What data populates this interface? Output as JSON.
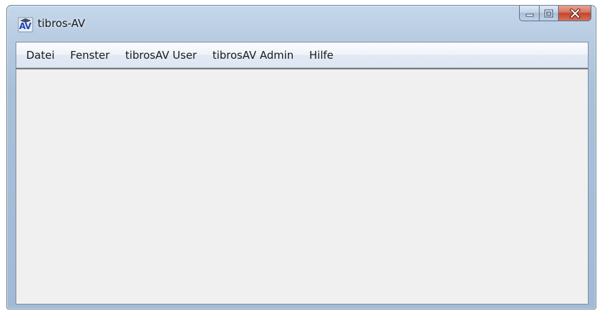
{
  "window": {
    "title": "tibros-AV",
    "icon": "tibros-av-app-icon",
    "controls": {
      "minimize_icon": "minimize-icon",
      "maximize_icon": "maximize-icon",
      "close_icon": "close-icon",
      "close_color": "#c2452a"
    }
  },
  "menubar": {
    "items": [
      {
        "label": "Datei"
      },
      {
        "label": "Fenster"
      },
      {
        "label": "tibrosAV User"
      },
      {
        "label": "tibrosAV Admin"
      },
      {
        "label": "Hilfe"
      }
    ]
  },
  "colors": {
    "frame": "#b9cde3",
    "client_background": "#f0f0f0"
  }
}
